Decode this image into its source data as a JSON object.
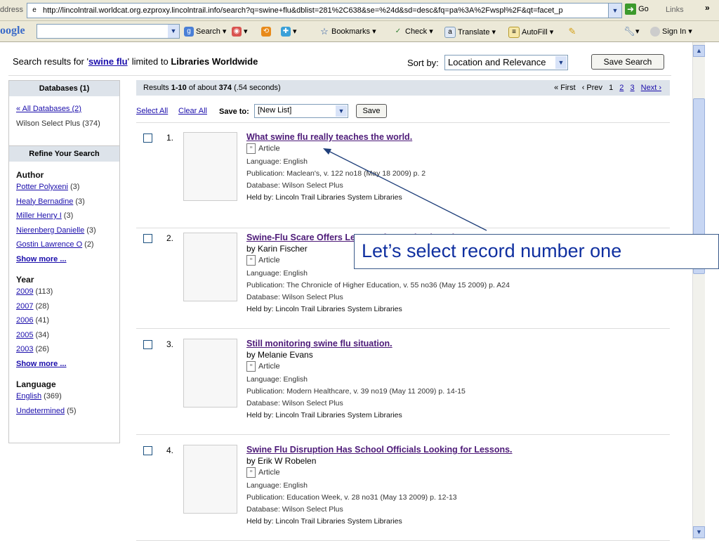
{
  "browser": {
    "address_label": "ddress",
    "url": "http://lincolntrail.worldcat.org.ezproxy.lincolntrail.info/search?q=swine+flu&dblist=281%2C638&se=%24d&sd=desc&fq=pa%3A%2Fwspl%2F&qt=facet_p",
    "go_label": "Go",
    "links_label": "Links",
    "chevron": "»"
  },
  "google_toolbar": {
    "logo": "oogle",
    "search_label": "Search",
    "bookmarks_label": "Bookmarks",
    "check_label": "Check",
    "translate_label": "Translate",
    "autofill_label": "AutoFill",
    "sign_in_label": "Sign In"
  },
  "search": {
    "prefix": "Search results for '",
    "query": "swine flu",
    "middle": "' limited to ",
    "scope": "Libraries Worldwide",
    "sort_label": "Sort by:",
    "sort_value": "Location and Relevance",
    "save_search_label": "Save Search"
  },
  "sidebar": {
    "databases_header": "Databases (1)",
    "all_databases": "« All Databases (2)",
    "selected_db": "Wilson Select Plus (374)",
    "refine_header": "Refine Your Search",
    "groups": [
      {
        "label": "Author",
        "items": [
          {
            "name": "Potter Polyxeni",
            "count": "(3)"
          },
          {
            "name": "Healy Bernadine",
            "count": "(3)"
          },
          {
            "name": "Miller Henry I",
            "count": "(3)"
          },
          {
            "name": "Nierenberg Danielle",
            "count": "(3)"
          },
          {
            "name": "Gostin Lawrence O",
            "count": "(2)"
          }
        ],
        "more": "Show more ..."
      },
      {
        "label": "Year",
        "items": [
          {
            "name": "2009",
            "count": "(113)"
          },
          {
            "name": "2007",
            "count": "(28)"
          },
          {
            "name": "2006",
            "count": "(41)"
          },
          {
            "name": "2005",
            "count": "(34)"
          },
          {
            "name": "2003",
            "count": "(26)"
          }
        ],
        "more": "Show more ..."
      },
      {
        "label": "Language",
        "items": [
          {
            "name": "English",
            "count": "(369)"
          },
          {
            "name": "Undetermined",
            "count": "(5)"
          }
        ]
      }
    ]
  },
  "results": {
    "count_prefix": "Results ",
    "count_range": "1-10",
    "count_mid": " of about ",
    "count_total": "374",
    "count_time": " (.54 seconds)",
    "pager": {
      "first": "« First",
      "prev": "‹ Prev",
      "pages": [
        "1",
        "2",
        "3"
      ],
      "next": "Next ›"
    },
    "select_all": "Select All",
    "clear_all": "Clear All",
    "save_to_label": "Save to:",
    "list_value": "[New List]",
    "save_label": "Save",
    "records": [
      {
        "num": "1.",
        "title": "What swine flu really teaches the world.",
        "author": "",
        "type": "Article",
        "language": "Language: English",
        "publication": "Publication: Maclean's, v. 122 no18 (May 18 2009) p. 2",
        "database": "Database: Wilson Select Plus",
        "held": "Held by: Lincoln Trail Libraries System Libraries"
      },
      {
        "num": "2.",
        "title": "Swine-Flu Scare Offers Lessons for Study Abroad Programs",
        "author": "by Karin Fischer",
        "type": "Article",
        "language": "Language: English",
        "publication": "Publication: The Chronicle of Higher Education, v. 55 no36 (May 15 2009) p. A24",
        "database": "Database: Wilson Select Plus",
        "held": "Held by: Lincoln Trail Libraries System Libraries"
      },
      {
        "num": "3.",
        "title": "Still monitoring swine flu situation.",
        "author": "by Melanie Evans",
        "type": "Article",
        "language": "Language: English",
        "publication": "Publication: Modern Healthcare, v. 39 no19 (May 11 2009) p. 14-15",
        "database": "Database: Wilson Select Plus",
        "held": "Held by: Lincoln Trail Libraries System Libraries"
      },
      {
        "num": "4.",
        "title": "Swine Flu Disruption Has School Officials Looking for Lessons.",
        "author": "by Erik W Robelen",
        "type": "Article",
        "language": "Language: English",
        "publication": "Publication: Education Week, v. 28 no31 (May 13 2009) p. 12-13",
        "database": "Database: Wilson Select Plus",
        "held": "Held by: Lincoln Trail Libraries System Libraries"
      }
    ]
  },
  "annotation": {
    "text": "Let’s select record number one"
  }
}
